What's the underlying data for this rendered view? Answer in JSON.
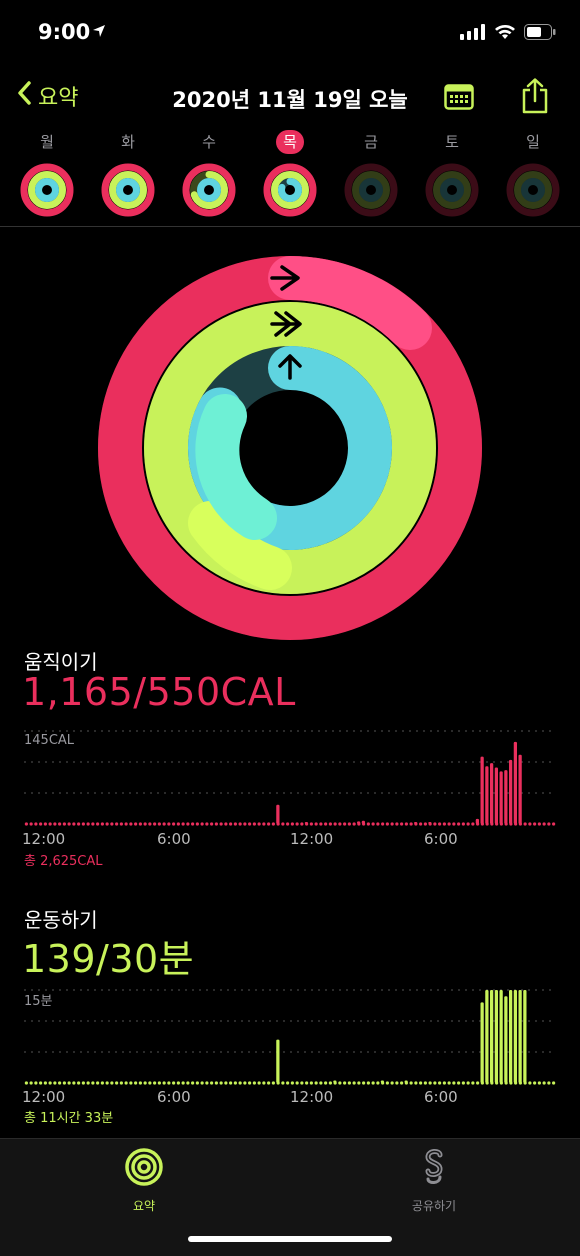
{
  "status_bar": {
    "time": "9:00",
    "location_icon": "location-arrow-icon",
    "signal_icon": "cellular-signal-icon",
    "wifi_icon": "wifi-icon",
    "battery_icon": "battery-icon"
  },
  "nav": {
    "back_label": "요약",
    "title": "2020년 11월 19일 오늘",
    "calendar_icon": "calendar-icon",
    "share_icon": "share-icon"
  },
  "week": {
    "days": [
      {
        "label": "월",
        "move": 1.0,
        "exercise": 1.0,
        "stand": 1.0,
        "today": false,
        "future": false
      },
      {
        "label": "화",
        "move": 1.0,
        "exercise": 1.0,
        "stand": 1.0,
        "today": false,
        "future": false
      },
      {
        "label": "수",
        "move": 1.0,
        "exercise": 0.7,
        "stand": 1.0,
        "today": false,
        "future": false
      },
      {
        "label": "목",
        "move": 1.0,
        "exercise": 1.0,
        "stand": 0.8,
        "today": true,
        "future": false
      },
      {
        "label": "금",
        "move": 0,
        "exercise": 0,
        "stand": 0,
        "today": false,
        "future": true
      },
      {
        "label": "토",
        "move": 0,
        "exercise": 0,
        "stand": 0,
        "today": false,
        "future": true
      },
      {
        "label": "일",
        "move": 0,
        "exercise": 0,
        "stand": 0,
        "today": false,
        "future": true
      }
    ]
  },
  "rings": {
    "move_progress": 2.12,
    "exercise_progress": 4.63,
    "stand_progress": 0.83,
    "colors": {
      "move": "#ea2f5d",
      "exercise": "#c8f25a",
      "stand": "#5fd4e0"
    }
  },
  "move": {
    "title": "움직이기",
    "value": "1,165/550CAL",
    "ymax_label": "145CAL",
    "ticks": [
      "12:00",
      "6:00",
      "12:00",
      "6:00"
    ],
    "total": "총 2,625CAL",
    "color": "#ea2f5d",
    "chart_data": {
      "type": "bar",
      "ylim": [
        0,
        145
      ],
      "peak_bins": [
        [
          53,
          30
        ],
        [
          59,
          1
        ],
        [
          70,
          4
        ],
        [
          71,
          5
        ],
        [
          85,
          1
        ],
        [
          82,
          2
        ],
        [
          95,
          8
        ],
        [
          96,
          105
        ],
        [
          97,
          90
        ],
        [
          98,
          95
        ],
        [
          99,
          88
        ],
        [
          100,
          82
        ],
        [
          101,
          84
        ],
        [
          102,
          100
        ],
        [
          103,
          128
        ],
        [
          104,
          108
        ]
      ]
    }
  },
  "exercise": {
    "title": "운동하기",
    "value": "139/30분",
    "ymax_label": "15분",
    "ticks": [
      "12:00",
      "6:00",
      "12:00",
      "6:00"
    ],
    "total": "총 11시간 33분",
    "color": "#c8f25a",
    "chart_data": {
      "type": "bar",
      "ylim": [
        0,
        15
      ],
      "peak_bins": [
        [
          53,
          7
        ],
        [
          65,
          0.4
        ],
        [
          75,
          0.4
        ],
        [
          80,
          0.4
        ],
        [
          96,
          13
        ],
        [
          97,
          15
        ],
        [
          98,
          15
        ],
        [
          99,
          15
        ],
        [
          100,
          15
        ],
        [
          101,
          14
        ],
        [
          102,
          15
        ],
        [
          103,
          15
        ],
        [
          104,
          15
        ],
        [
          105,
          15
        ]
      ]
    }
  },
  "tabbar": {
    "tabs": [
      {
        "label": "요약",
        "icon": "activity-rings-icon",
        "active": true
      },
      {
        "label": "공유하기",
        "icon": "sharing-icon",
        "active": false
      }
    ]
  }
}
